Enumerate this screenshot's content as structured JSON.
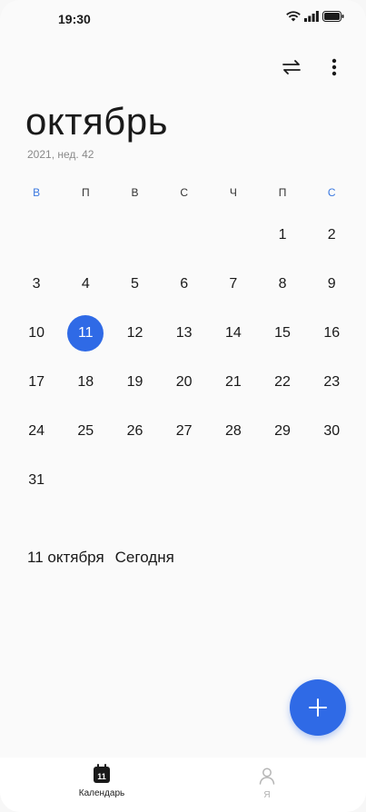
{
  "status_bar": {
    "time": "19:30"
  },
  "header": {
    "month": "октябрь",
    "subtitle": "2021, нед. 42"
  },
  "weekdays": [
    "В",
    "П",
    "В",
    "С",
    "Ч",
    "П",
    "С"
  ],
  "weeks": [
    [
      "",
      "",
      "",
      "",
      "",
      "1",
      "2"
    ],
    [
      "3",
      "4",
      "5",
      "6",
      "7",
      "8",
      "9"
    ],
    [
      "10",
      "11",
      "12",
      "13",
      "14",
      "15",
      "16"
    ],
    [
      "17",
      "18",
      "19",
      "20",
      "21",
      "22",
      "23"
    ],
    [
      "24",
      "25",
      "26",
      "27",
      "28",
      "29",
      "30"
    ],
    [
      "31",
      "",
      "",
      "",
      "",
      "",
      ""
    ]
  ],
  "today": "11",
  "selected": {
    "date": "11 октября",
    "label": "Сегодня"
  },
  "nav": {
    "calendar": {
      "label": "Календарь",
      "icon_day": "11"
    },
    "me": {
      "label": "Я"
    }
  },
  "colors": {
    "accent": "#2f6ae6",
    "sunday": "#3a78e0"
  }
}
